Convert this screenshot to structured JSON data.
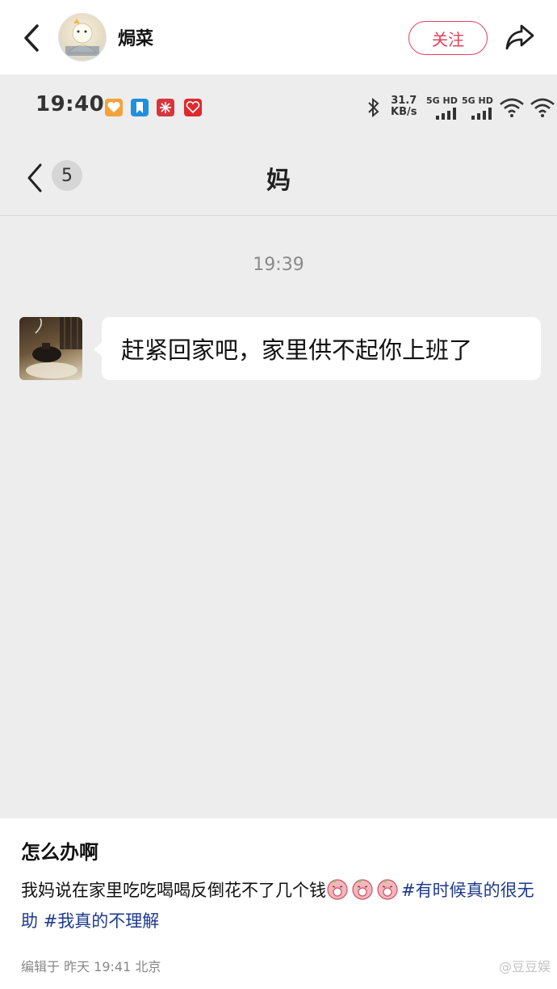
{
  "header": {
    "author_name": "焗菜",
    "follow_label": "关注",
    "icons": [
      "back-icon",
      "avatar",
      "share-icon"
    ]
  },
  "screenshot": {
    "status_bar": {
      "time": "19:40",
      "net_speed_value": "31.7",
      "net_speed_unit": "KB/s",
      "signal_labels": [
        "5G HD",
        "5G HD"
      ],
      "icons": [
        "heart-app-icon",
        "bookmark-app-icon",
        "snow-app-icon",
        "love-app-icon",
        "bluetooth-icon",
        "signal-icon",
        "wifi-icon"
      ]
    },
    "chat": {
      "unread_count": "5",
      "title": "妈",
      "timestamp": "19:39",
      "message": "赶紧回家吧，家里供不起你上班了"
    }
  },
  "post": {
    "title": "怎么办啊",
    "body_text": "我妈说在家里吃吃喝喝反倒花不了几个钱",
    "hashtag_1": "#有时候真的很无助",
    "hashtag_2": "#我真的不理解",
    "emoji_count": 3,
    "meta": "编辑于  昨天 19:41 北京",
    "watermark": "@豆豆娱"
  },
  "colors": {
    "accent": "#e0415b",
    "hashtag": "#1e3a8a",
    "chat_bg": "#ededed"
  }
}
